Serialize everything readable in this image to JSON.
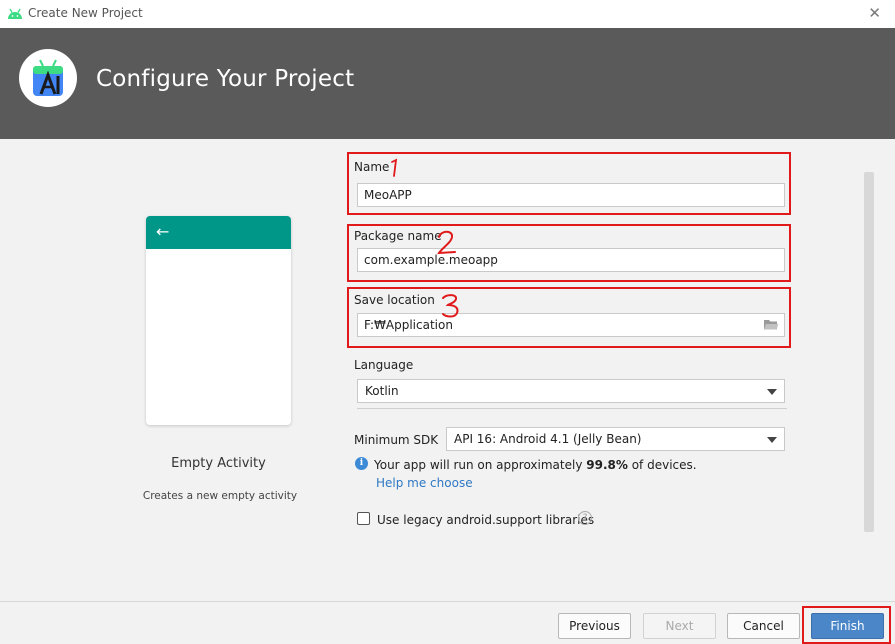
{
  "window": {
    "title": "Create New Project",
    "close_glyph": "✕"
  },
  "banner": {
    "heading": "Configure Your Project"
  },
  "template": {
    "title": "Empty Activity",
    "description": "Creates a new empty activity",
    "back_glyph": "←",
    "toolbar_color": "#009688"
  },
  "form": {
    "name_label": "Name",
    "name_value": "MeoAPP",
    "package_label": "Package name",
    "package_value": "com.example.meoapp",
    "location_label": "Save location",
    "location_value": "F:₩Application",
    "language_label": "Language",
    "language_value": "Kotlin",
    "min_sdk_label": "Minimum SDK",
    "min_sdk_value": "API 16: Android 4.1 (Jelly Bean)",
    "info_prefix": "Your app will run on approximately",
    "info_percent": "99.8%",
    "info_suffix": "of devices.",
    "help_link": "Help me choose",
    "legacy_label": "Use legacy android.support libraries",
    "legacy_checked": false
  },
  "buttons": {
    "previous": "Previous",
    "next": "Next",
    "cancel": "Cancel",
    "finish": "Finish"
  },
  "annotations": {
    "marker_color": "#e01a1a",
    "numbers": [
      "1",
      "2",
      "3"
    ]
  },
  "icons": {
    "app": "android-icon",
    "logo": "android-studio-icon",
    "folder": "folder-open-icon",
    "info": "info-icon",
    "help": "question-mark-icon"
  }
}
